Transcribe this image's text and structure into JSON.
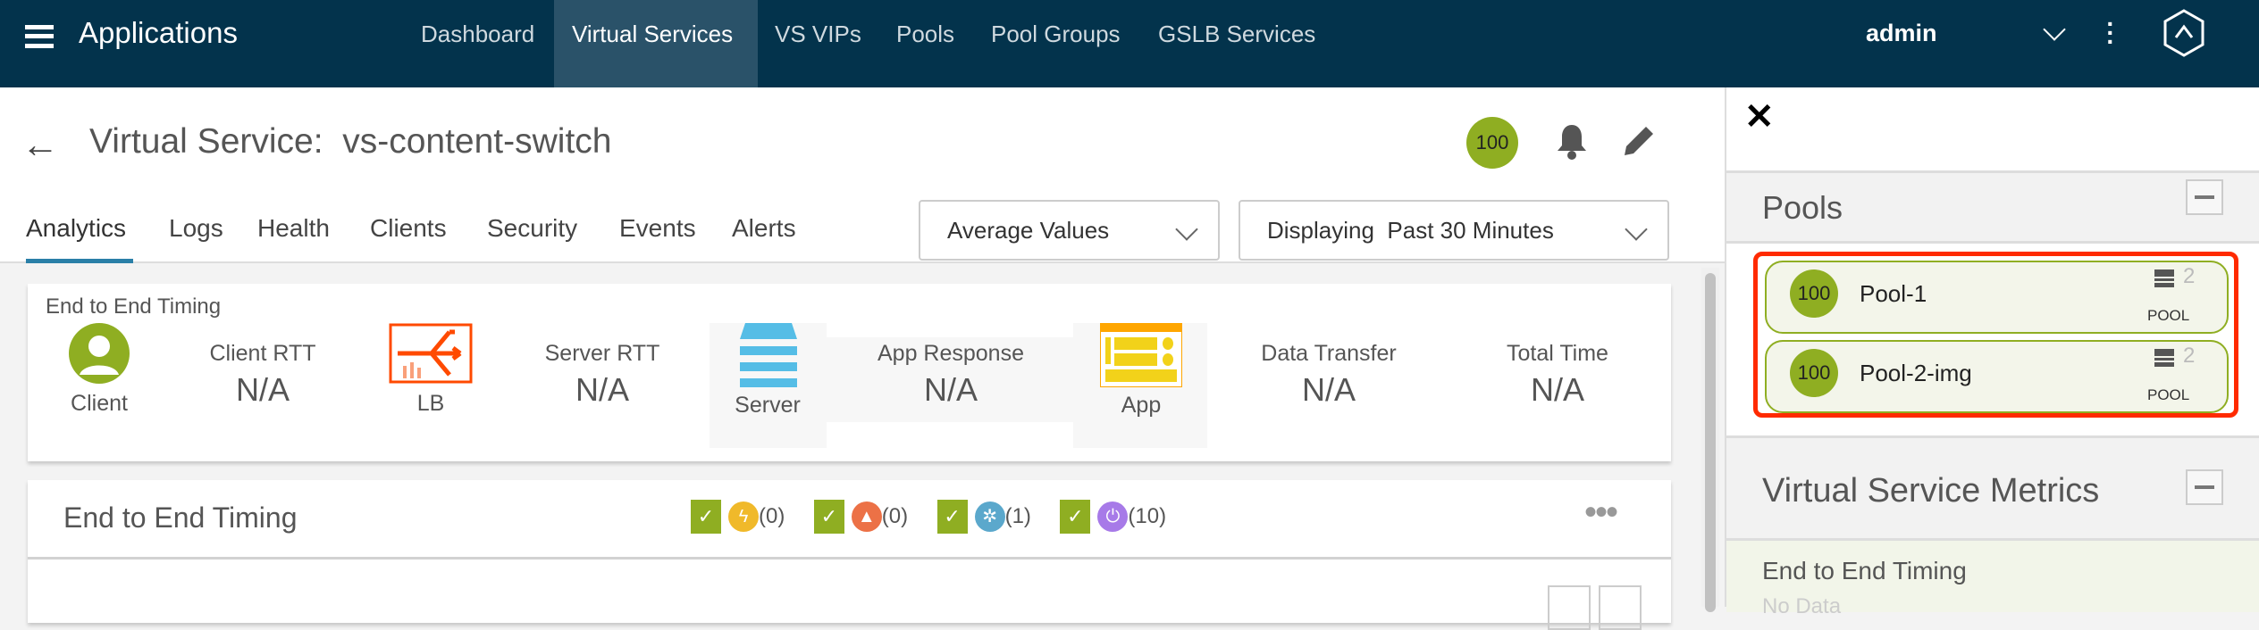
{
  "topnav": {
    "title": "Applications",
    "items": [
      "Dashboard",
      "Virtual Services",
      "VS VIPs",
      "Pools",
      "Pool Groups",
      "GSLB Services"
    ],
    "active": "Virtual Services",
    "user": "admin"
  },
  "header": {
    "title": "Virtual Service:  vs-content-switch",
    "health": "100"
  },
  "tabs": [
    "Analytics",
    "Logs",
    "Health",
    "Clients",
    "Security",
    "Events",
    "Alerts"
  ],
  "dropdowns": {
    "values": "Average Values",
    "time": "Displaying  Past 30 Minutes"
  },
  "timing_card": {
    "title": "End to End Timing",
    "client": "Client",
    "lb": "LB",
    "server": "Server",
    "app": "App",
    "metrics": [
      {
        "label": "Client RTT",
        "value": "N/A"
      },
      {
        "label": "Server RTT",
        "value": "N/A"
      },
      {
        "label": "App Response",
        "value": "N/A"
      },
      {
        "label": "Data Transfer",
        "value": "N/A"
      },
      {
        "label": "Total Time",
        "value": "N/A"
      }
    ]
  },
  "chart_card": {
    "title": "End to End Timing",
    "filters": [
      {
        "icon": "lightning-icon",
        "count": "(0)",
        "color": "#f0b92a"
      },
      {
        "icon": "bell-icon",
        "count": "(0)",
        "color": "#ec7146"
      },
      {
        "icon": "gear-icon",
        "count": "(1)",
        "color": "#5ba8cc"
      },
      {
        "icon": "power-icon",
        "count": "(10)",
        "color": "#a77ae8"
      }
    ]
  },
  "right_panel": {
    "pools_title": "Pools",
    "pools": [
      {
        "health": "100",
        "name": "Pool-1",
        "servers": "2",
        "type": "POOL"
      },
      {
        "health": "100",
        "name": "Pool-2-img",
        "servers": "2",
        "type": "POOL"
      }
    ],
    "metrics_title": "Virtual Service Metrics",
    "metric_name": "End to End Timing",
    "metric_value": "No Data"
  },
  "colors": {
    "nav": "#03334c",
    "health": "#8fae22",
    "highlight": "#ff2a00",
    "accent": "#2a7fa7"
  }
}
